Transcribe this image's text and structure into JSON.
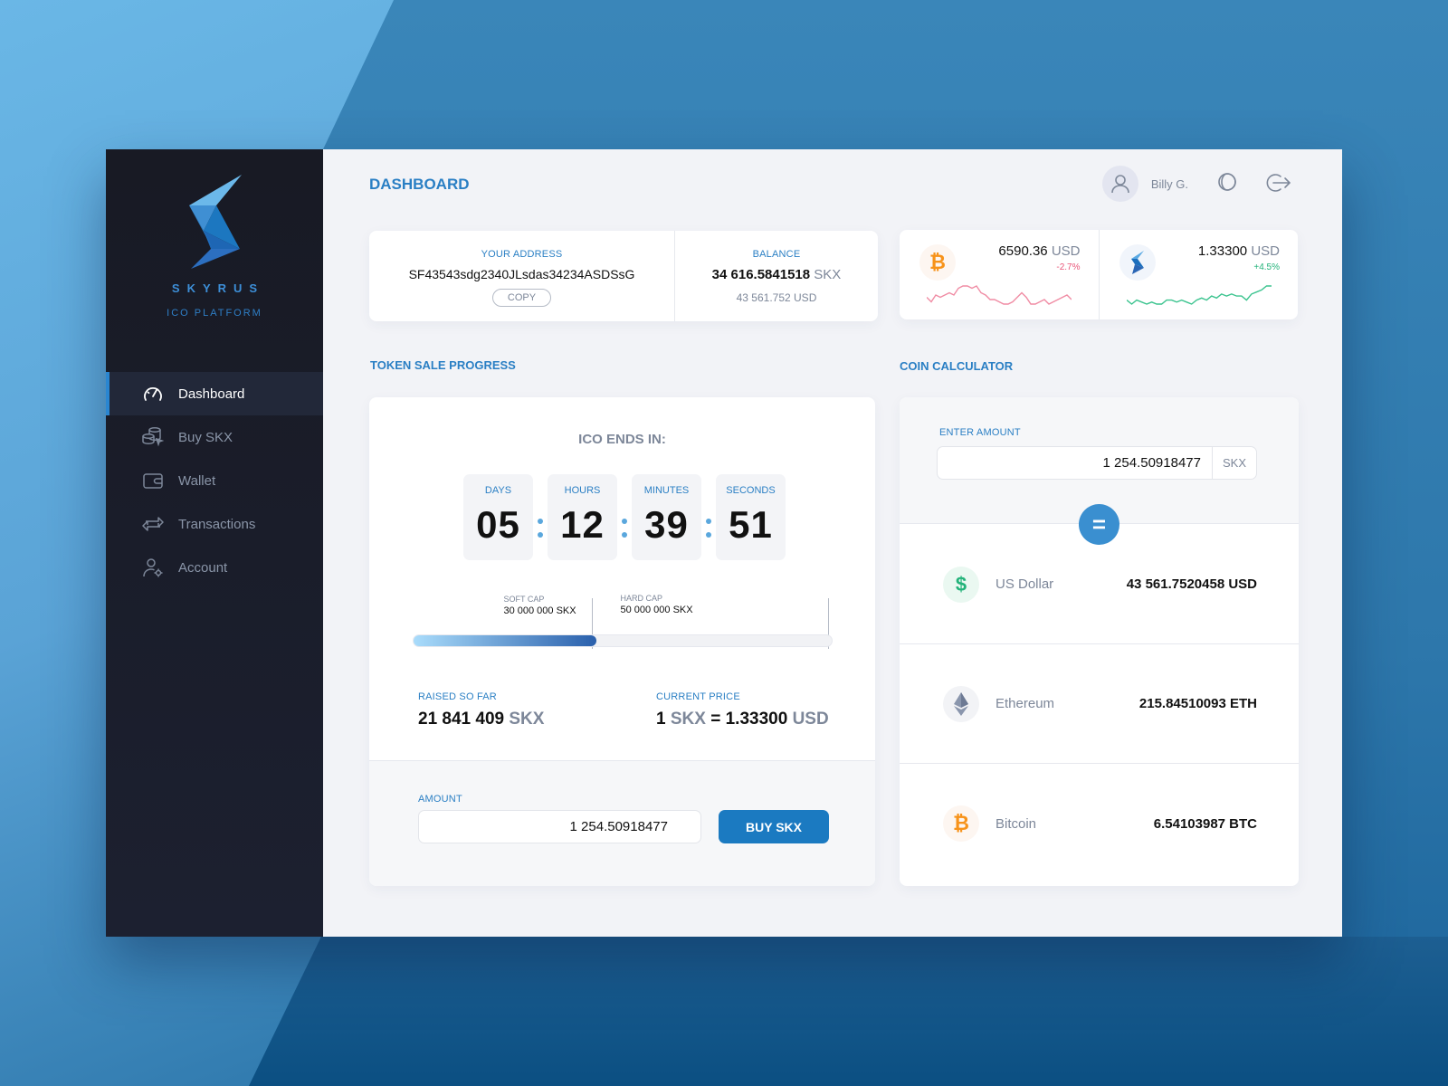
{
  "brand": {
    "name": "SKYRUS",
    "subtitle": "ICO PLATFORM"
  },
  "sidebar": {
    "items": [
      {
        "label": "Dashboard",
        "icon": "speedometer-icon",
        "active": true
      },
      {
        "label": "Buy SKX",
        "icon": "coins-cursor-icon",
        "active": false
      },
      {
        "label": "Wallet",
        "icon": "wallet-icon",
        "active": false
      },
      {
        "label": "Transactions",
        "icon": "exchange-arrows-icon",
        "active": false
      },
      {
        "label": "Account",
        "icon": "user-settings-icon",
        "active": false
      }
    ]
  },
  "header": {
    "title": "DASHBOARD",
    "user_name": "Billy G.",
    "icons": [
      "user-avatar-icon",
      "theme-toggle-icon",
      "logout-icon"
    ]
  },
  "address_card": {
    "address_label": "YOUR ADDRESS",
    "address": "SF43543sdg2340JLsdas34234ASDSsG",
    "copy_label": "COPY",
    "balance_label": "BALANCE",
    "balance_value": "34 616.5841518",
    "balance_unit": "SKX",
    "balance_usd": "43 561.752 USD"
  },
  "tickers": [
    {
      "coin": "Bitcoin",
      "icon": "bitcoin-icon",
      "price": "6590.36",
      "unit": "USD",
      "change": "-2.7%",
      "trend": "down",
      "color": "#f08ca4",
      "sparkline": [
        5,
        3,
        6,
        5,
        6,
        7,
        6,
        9,
        10,
        10,
        9,
        10,
        7,
        6,
        4,
        4,
        3,
        2,
        2,
        3,
        5,
        7,
        5,
        2,
        2,
        3,
        4,
        2,
        3,
        4,
        5,
        6,
        4
      ]
    },
    {
      "coin": "Skyrus",
      "icon": "skyrus-icon",
      "price": "1.33300",
      "unit": "USD",
      "change": "+4.5%",
      "trend": "up",
      "color": "#3cc48f",
      "sparkline": [
        3,
        1,
        3,
        2,
        1,
        2,
        1,
        1,
        3,
        3,
        2,
        3,
        2,
        1,
        3,
        4,
        3,
        5,
        4,
        6,
        5,
        6,
        5,
        5,
        3,
        6,
        7,
        8,
        10,
        10
      ]
    }
  ],
  "token_sale": {
    "section_title": "TOKEN SALE PROGRESS",
    "ends_label": "ICO ENDS IN:",
    "countdown": [
      {
        "label": "DAYS",
        "value": "05"
      },
      {
        "label": "HOURS",
        "value": "12"
      },
      {
        "label": "MINUTES",
        "value": "39"
      },
      {
        "label": "SECONDS",
        "value": "51"
      }
    ],
    "progress_fraction": 0.437,
    "soft_cap": {
      "label": "SOFT CAP",
      "value": "30 000 000 SKX",
      "fraction": 0.6
    },
    "hard_cap": {
      "label": "HARD CAP",
      "value": "50 000 000 SKX",
      "fraction": 1.0
    },
    "raised_label": "RAISED SO FAR",
    "raised_value": "21 841 409",
    "raised_unit": "SKX",
    "price_label": "CURRENT PRICE",
    "price_one": "1",
    "price_unit_left": "SKX",
    "price_eq": "=",
    "price_value": "1.33300",
    "price_unit_right": "USD",
    "amount_label": "AMOUNT",
    "amount_value": "1 254.50918477",
    "buy_label": "BUY SKX"
  },
  "calculator": {
    "section_title": "COIN CALCULATOR",
    "enter_label": "ENTER AMOUNT",
    "amount_value": "1 254.50918477",
    "amount_unit": "SKX",
    "equals_label": "=",
    "conversions": [
      {
        "name": "US Dollar",
        "icon": "dollar-icon",
        "value": "43 561.7520458 USD"
      },
      {
        "name": "Ethereum",
        "icon": "ethereum-icon",
        "value": "215.84510093 ETH"
      },
      {
        "name": "Bitcoin",
        "icon": "bitcoin-icon",
        "value": "6.54103987 BTC"
      }
    ]
  },
  "colors": {
    "accent": "#2a7fc4",
    "button": "#1b7ac1",
    "sidebar": "#1a1c27",
    "negative": "#e9577a",
    "positive": "#23b37a"
  }
}
